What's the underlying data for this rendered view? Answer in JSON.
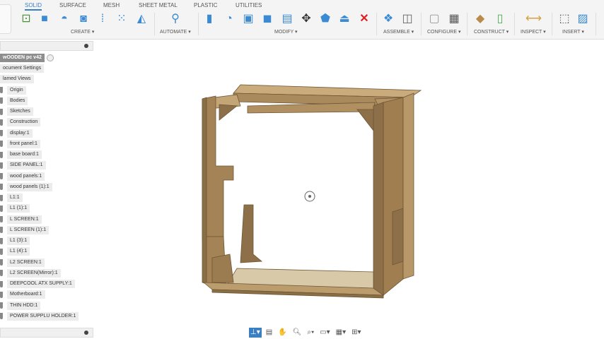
{
  "toolbar": {
    "tabs": [
      "SOLID",
      "SURFACE",
      "MESH",
      "SHEET METAL",
      "PLASTIC",
      "UTILITIES"
    ],
    "active_tab": "SOLID",
    "groups": [
      "CREATE ▾",
      "AUTOMATE ▾",
      "MODIFY ▾",
      "ASSEMBLE ▾",
      "CONFIGURE ▾",
      "CONSTRUCT ▾",
      "INSPECT ▾",
      "INSERT ▾"
    ]
  },
  "browser": {
    "root": "wOODEN pc v42",
    "items": [
      "ocument Settings",
      "lamed Views",
      "Origin",
      "Bodies",
      "Sketches",
      "Construction",
      "display:1",
      "front panel:1",
      "base board:1",
      "SIDE PANEL:1",
      "wood panels:1",
      "wood panels (1):1",
      "L1:1",
      "L1 (1):1",
      "L SCREEN:1",
      "L SCREEN (1):1",
      "L1 (3):1",
      "L1 (4):1",
      "L2 SCREEN:1",
      "L2 SCREEN(Mirror):1",
      "DEEPCOOL ATX SUPPLY:1",
      "Motherboard:1",
      "THIN HDD:1",
      "POWER SUPPLU HOLDER:1"
    ]
  },
  "colors": {
    "accent": "#3a7fc4",
    "wood": "#b99a6c",
    "wood_dark": "#8a6e45"
  }
}
